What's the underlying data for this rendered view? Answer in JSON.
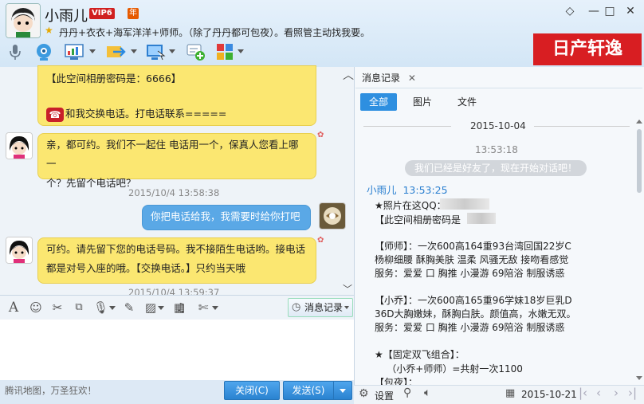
{
  "window": {
    "contact_name": "小雨儿",
    "vip_label": "VIP6",
    "year_label": "年",
    "signature": "丹丹+衣衣+海军洋洋+师师。（除了丹丹都可包夜）。看照管主动找我要。",
    "controls": [
      "◇",
      "—",
      "□",
      "✕"
    ]
  },
  "ad_banner": "日产轩逸",
  "chat": {
    "messages": [
      {
        "side": "left",
        "text1": "【此空间相册密码是：6666】",
        "text2": "和我交换电话。打电话联系====="
      },
      {
        "side": "left",
        "text1": "亲，都可约。我们不一起住 电话用一个，保真人您看上哪一",
        "text2": "个？先留个电话吧？"
      },
      {
        "timestamp": "2015/10/4 13:58:38"
      },
      {
        "side": "right",
        "text1": "你把电话给我，我需要时给你打吧"
      },
      {
        "side": "left",
        "text1": "可约。请先留下您的电话号码。我不接陌生电话哟。接电话",
        "text2": "都是对号入座的哦。【交换电话。】只约当天哦"
      },
      {
        "timestamp": "2015/10/4 13:59:37"
      }
    ]
  },
  "input_toolbar": {
    "message_record_label": "消息记录"
  },
  "bottom": {
    "tip": "腾讯地图，万圣狂欢！",
    "close_label": "关闭(C)",
    "send_label": "发送(S)"
  },
  "history": {
    "tab_label": "消息记录",
    "filters": [
      "全部",
      "图片",
      "文件"
    ],
    "date": "2015-10-04",
    "time1": "13:53:18",
    "system_note": "我们已经是好友了，现在开始对话吧！",
    "sender_line": "小雨儿  13:53:25",
    "lines": [
      "★照片在这QQ：",
      "【此空间相册密码是",
      "",
      "【师师】：一次600高164重93台湾回国22岁C",
      "杨柳细腰 酥胸美肤 温柔 风骚无敌 接吻看感觉",
      "服务：爱爱 口 胸推 小漫游 69陪浴 制服诱惑",
      "",
      "【小乔】：一次600高165重96学妹18岁巨乳D",
      "36D大胸嫩妹，酥胸白肤。颜值高，水嫩无双。",
      "服务：爱爱 口 胸推 小漫游 69陪浴 制服诱惑",
      "",
      "★【固定双飞组合】：",
      "    （小乔+师师）=共射一次1100",
      "【包夜】："
    ],
    "settings_label": "设置",
    "date_picker": "2015-10-21"
  }
}
